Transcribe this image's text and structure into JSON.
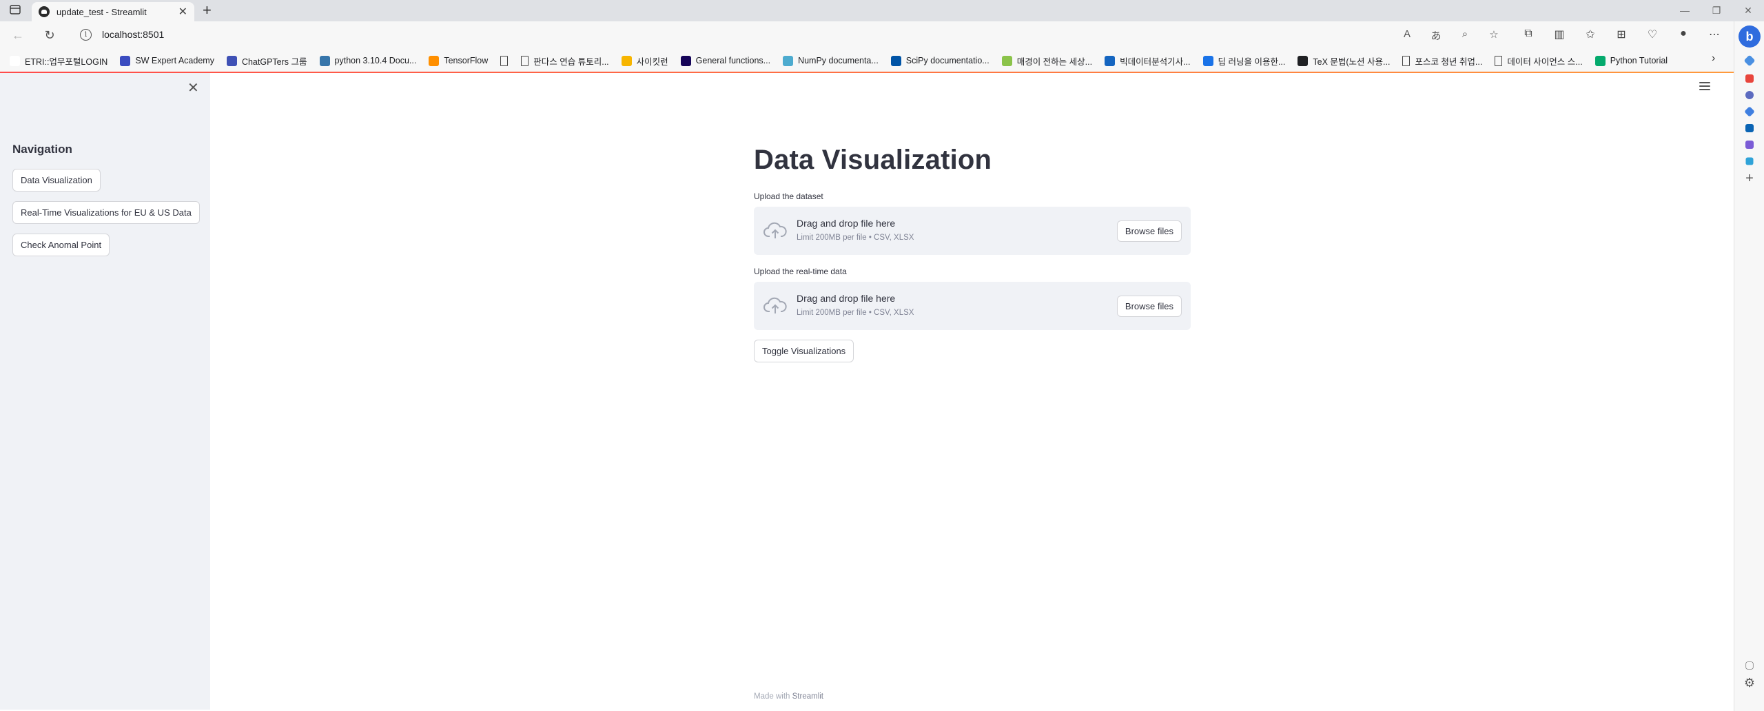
{
  "browser": {
    "tab_title": "update_test - Streamlit",
    "url": "localhost:8501",
    "bookmarks": [
      {
        "label": "ETRI::업무포털LOGIN",
        "icon": "ribbon-icon",
        "color": "#ffffff"
      },
      {
        "label": "SW Expert Academy",
        "icon": "swea-icon",
        "color": "#3b4cc0"
      },
      {
        "label": "ChatGPTers 그룹",
        "icon": "chatgpters-icon",
        "color": "#3f51b5"
      },
      {
        "label": "python 3.10.4 Docu...",
        "icon": "python-icon",
        "color": "#3776ab"
      },
      {
        "label": "TensorFlow",
        "icon": "tensorflow-icon",
        "color": "#ff8f00"
      },
      {
        "label": "",
        "icon": "page-icon",
        "color": "#ffffff"
      },
      {
        "label": "판다스 연습 튜토리...",
        "icon": "page-icon",
        "color": "#ffffff"
      },
      {
        "label": "사이킷런",
        "icon": "chart-icon",
        "color": "#f7b500"
      },
      {
        "label": "General functions...",
        "icon": "pandas-icon",
        "color": "#150458"
      },
      {
        "label": "NumPy documenta...",
        "icon": "numpy-icon",
        "color": "#4dabcf"
      },
      {
        "label": "SciPy documentatio...",
        "icon": "scipy-icon",
        "color": "#0054a6"
      },
      {
        "label": "매경이 전하는 세상...",
        "icon": "leaf-icon",
        "color": "#8bc34a"
      },
      {
        "label": "빅데이터분석기사...",
        "icon": "k-icon",
        "color": "#1565c0"
      },
      {
        "label": "딥 러닝을 이용한...",
        "icon": "book-icon",
        "color": "#1a73e8"
      },
      {
        "label": "TeX 문법(노션 사용...",
        "icon": "wiki-icon",
        "color": "#202124"
      },
      {
        "label": "포스코 청년 취업...",
        "icon": "page-icon",
        "color": "#ffffff"
      },
      {
        "label": "데이터 사이언스 스...",
        "icon": "page-icon",
        "color": "#ffffff"
      },
      {
        "label": "Python Tutorial",
        "icon": "w3-icon",
        "color": "#04aa6d"
      }
    ]
  },
  "sidebar": {
    "heading": "Navigation",
    "buttons": [
      {
        "label": "Data Visualization"
      },
      {
        "label": "Real-Time Visualizations for EU & US Data"
      },
      {
        "label": "Check Anomal Point"
      }
    ]
  },
  "main": {
    "title": "Data Visualization",
    "uploaders": [
      {
        "label": "Upload the dataset",
        "drop_text": "Drag and drop file here",
        "limit_text": "Limit 200MB per file • CSV, XLSX",
        "button": "Browse files"
      },
      {
        "label": "Upload the real-time data",
        "drop_text": "Drag and drop file here",
        "limit_text": "Limit 200MB per file • CSV, XLSX",
        "button": "Browse files"
      }
    ],
    "toggle_button": "Toggle Visualizations"
  },
  "footer": {
    "prefix": "Made with",
    "brand": "Streamlit"
  },
  "colors": {
    "accent": "#ff4b4b",
    "sidebar_bg": "#f0f2f6",
    "text": "#31333f"
  }
}
